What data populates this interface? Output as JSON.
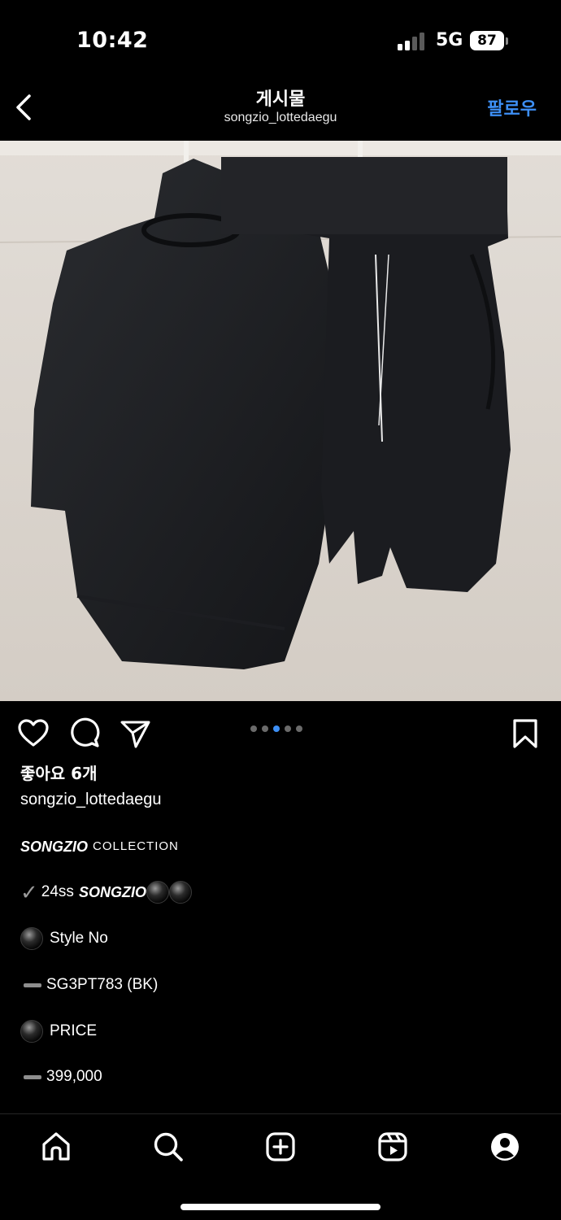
{
  "status": {
    "time": "10:42",
    "network": "5G",
    "battery": "87"
  },
  "header": {
    "title": "게시물",
    "username": "songzio_lottedaegu",
    "follow_label": "팔로우"
  },
  "post": {
    "image_description_icon": "product-photo",
    "carousel": {
      "count": 5,
      "active_index": 2
    },
    "likes": "좋아요 6개",
    "caption_username": "songzio_lottedaegu",
    "caption_lines": {
      "brand": "SONGZIO",
      "collection": "COLLECTION",
      "season": "24ss",
      "style_label": "Style No",
      "style_value": "SG3PT783 (BK)",
      "price_label": "PRICE",
      "price_value": "399,000"
    }
  },
  "tabbar": {
    "items": [
      "home-icon",
      "search-icon",
      "create-icon",
      "reels-icon",
      "profile-icon"
    ]
  },
  "colors": {
    "accent": "#3d8ff5",
    "background": "#000000"
  }
}
